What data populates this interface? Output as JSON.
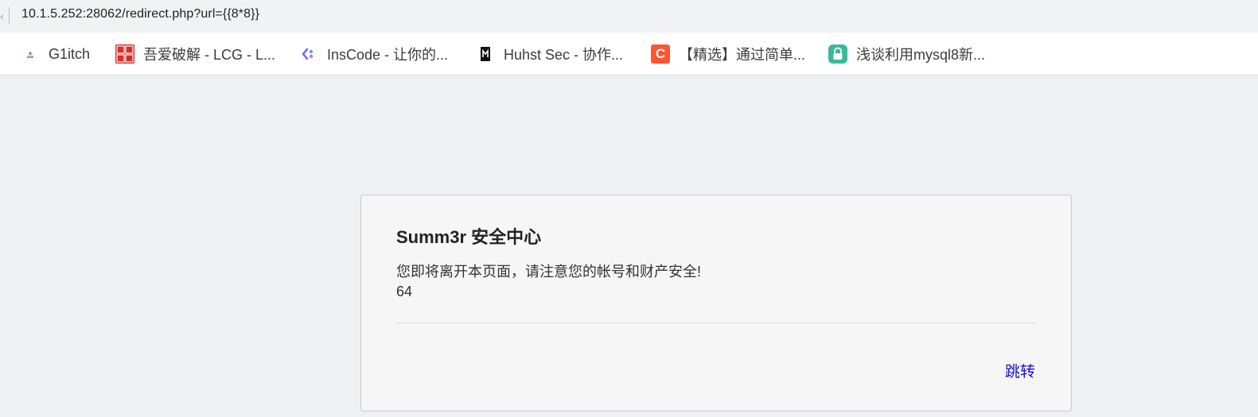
{
  "address_bar": {
    "url": "10.1.5.252:28062/redirect.php?url={{8*8}}"
  },
  "bookmarks": [
    {
      "label": "G1itch",
      "icon": "g1itch-icon"
    },
    {
      "label": "吾爱破解 - LCG - L...",
      "icon": "52pojie-icon"
    },
    {
      "label": "InsCode - 让你的...",
      "icon": "inscode-icon"
    },
    {
      "label": "Huhst Sec - 协作...",
      "icon": "huhst-sec-icon"
    },
    {
      "label": "【精选】通过简单...",
      "icon": "csdn-icon"
    },
    {
      "label": "浅谈利用mysql8新...",
      "icon": "lock-icon"
    }
  ],
  "card": {
    "title": "Summ3r 安全中心",
    "message": "您即将离开本页面，请注意您的帐号和财产安全!",
    "value": "64",
    "link_label": "跳转"
  },
  "colors": {
    "page_bg": "#eef1f4",
    "card_bg": "#f6f6f6",
    "link": "#1a0dcf",
    "csdn_red": "#fc5531"
  }
}
